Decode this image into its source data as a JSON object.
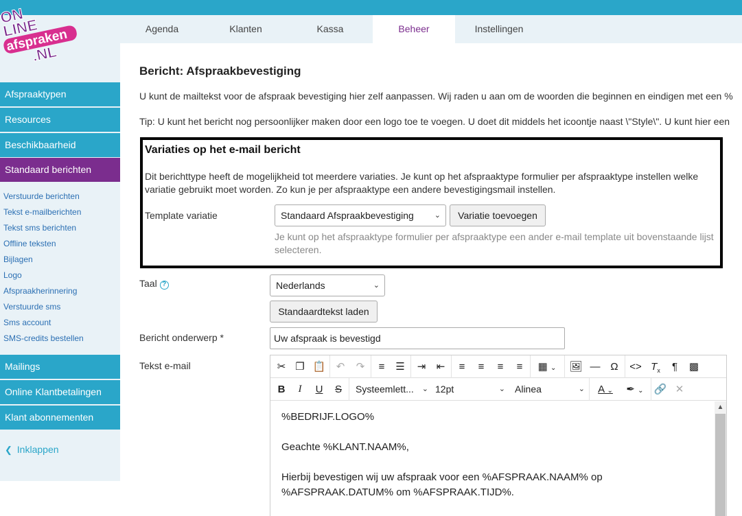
{
  "logo": {
    "line1": "ON",
    "line2": "LINE",
    "line3": "afspraken",
    "line4": ".NL"
  },
  "tabs": [
    {
      "label": "Agenda",
      "active": false
    },
    {
      "label": "Klanten",
      "active": false
    },
    {
      "label": "Kassa",
      "active": false
    },
    {
      "label": "Beheer",
      "active": true
    },
    {
      "label": "Instellingen",
      "active": false
    }
  ],
  "sidebar": {
    "main_top": [
      {
        "label": "Afspraaktypen"
      },
      {
        "label": "Resources"
      },
      {
        "label": "Beschikbaarheid"
      },
      {
        "label": "Standaard berichten",
        "active": true
      }
    ],
    "sub": [
      "Verstuurde berichten",
      "Tekst e-mailberichten",
      "Tekst sms berichten",
      "Offline teksten",
      "Bijlagen",
      "Logo",
      "Afspraakherinnering",
      "Verstuurde sms",
      "Sms account",
      "SMS-credits bestellen"
    ],
    "main_bottom": [
      {
        "label": "Mailings"
      },
      {
        "label": "Online Klantbetalingen"
      },
      {
        "label": "Klant abonnementen"
      }
    ],
    "collapse_label": "Inklappen"
  },
  "main": {
    "title": "Bericht: Afspraakbevestiging",
    "intro1": "U kunt de mailtekst voor de afspraak bevestiging hier zelf aanpassen. Wij raden u aan om de woorden die beginnen en eindigen met een %",
    "intro2": "Tip: U kunt het bericht nog persoonlijker maken door een logo toe te voegen. U doet dit middels het icoontje naast \\\"Style\\\". U kunt hier een",
    "variation": {
      "title": "Variaties op het e-mail bericht",
      "description": "Dit berichttype heeft de mogelijkheid tot meerdere variaties. Je kunt op het afspraaktype formulier per afspraaktype instellen welke variatie gebruikt moet worden. Zo kun je per afspraaktype een andere bevestigingsmail instellen.",
      "template_label": "Template variatie",
      "template_value": "Standaard Afspraakbevestiging",
      "add_button": "Variatie toevoegen",
      "hint": "Je kunt op het afspraaktype formulier per afspraaktype een ander e-mail template uit bovenstaande lijst selecteren."
    },
    "language_label": "Taal",
    "language_value": "Nederlands",
    "load_default_button": "Standaardtekst laden",
    "subject_label": "Bericht onderwerp *",
    "subject_value": "Uw afspraak is bevestigd",
    "email_text_label": "Tekst e-mail",
    "editor": {
      "font_family": "Systeemlett...",
      "font_size": "12pt",
      "block_format": "Alinea",
      "paragraphs": [
        "%BEDRIJF.LOGO%",
        "Geachte %KLANT.NAAM%,",
        "Hierbij bevestigen wij uw afspraak voor een %AFSPRAAK.NAAM% op %AFSPRAAK.DATUM% om %AFSPRAAK.TIJD%."
      ]
    }
  },
  "colors": {
    "accent": "#2aa6c9",
    "active": "#7b2d8e",
    "sidebar_bg": "#e9f2f7",
    "link": "#2b6fb3"
  }
}
